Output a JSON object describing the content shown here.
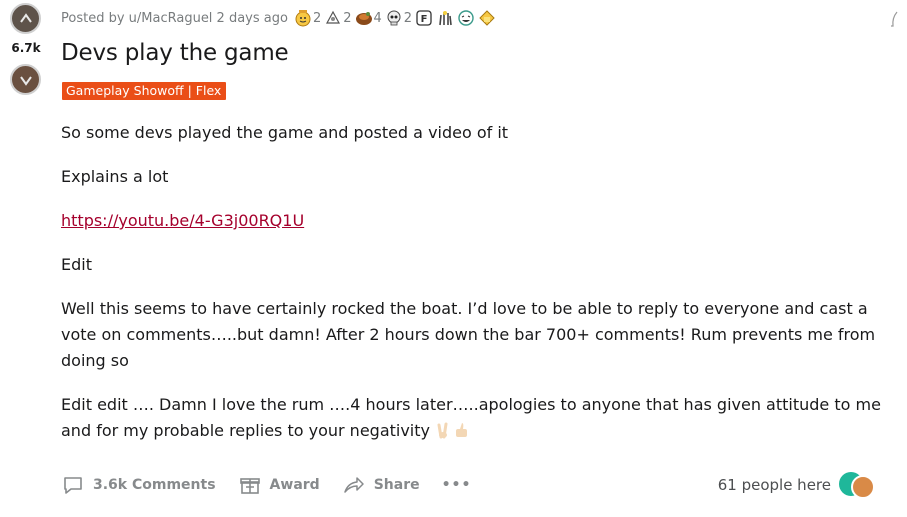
{
  "post": {
    "posted_by": "Posted by u/MacRaguel 2 days ago",
    "vote_count": "6.7k",
    "title": "Devs play the game",
    "flair": "Gameplay Showoff | Flex",
    "awards": [
      {
        "icon": "wholesome-award-icon",
        "count": "2"
      },
      {
        "icon": "helpful-award-icon",
        "count": "2"
      },
      {
        "icon": "tree-hug-award-icon",
        "count": "4"
      },
      {
        "icon": "skull-award-icon",
        "count": "2"
      },
      {
        "icon": "press-f-award-icon",
        "count": ""
      },
      {
        "icon": "take-my-energy-award-icon",
        "count": ""
      },
      {
        "icon": "laughing-award-icon",
        "count": ""
      },
      {
        "icon": "gold-award-icon",
        "count": ""
      }
    ],
    "body": {
      "p1": "So some devs played the game and posted a video of it",
      "p2": "Explains a lot",
      "link": "https://youtu.be/4-G3j00RQ1U",
      "p4": "Edit",
      "p5": "Well this seems to have certainly rocked the boat. I’d love to be able to reply to everyone and cast a vote on comments…..but damn! After 2 hours down the bar 700+ comments! Rum prevents me from doing so",
      "p6": "Edit edit …. Damn I love the rum ….4 hours later…..apologies to anyone that has given attitude to me and for my probable replies to your negativity"
    },
    "actions": {
      "comments": "3.6k Comments",
      "award": "Award",
      "share": "Share",
      "more": "•••"
    },
    "presence": "61 people here"
  }
}
